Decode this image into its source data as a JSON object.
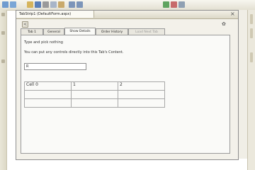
{
  "colors": {
    "toolbar_bg": "#e3e0d2",
    "frame_border": "#8e8e8e",
    "content_bg": "#fafaf8"
  },
  "toolbar": {
    "icons": [
      "back-icon",
      "forward-icon",
      "home-icon",
      "save-icon",
      "cut-icon",
      "copy-icon",
      "paste-icon",
      "undo-icon",
      "redo-icon",
      "run-icon",
      "debug-icon",
      "find-icon"
    ]
  },
  "document": {
    "tab_title": "TabStrip1 (DefaultForm.aspx)",
    "close_glyph": "×",
    "smarttag_glyph": "<",
    "tabs": [
      {
        "label": "Tab 1"
      },
      {
        "label": "General"
      },
      {
        "label": "Show Details"
      },
      {
        "label": "Order History"
      },
      {
        "label": "Load Next Tab"
      }
    ],
    "content": {
      "line1": "Type and pick nothing",
      "line2": "You can put any controls directly into this Tab's Content.",
      "textbox_value": "R",
      "table": [
        [
          "Cell 0",
          "1",
          "2"
        ],
        [
          "",
          "",
          ""
        ],
        [
          "",
          "",
          ""
        ]
      ]
    }
  }
}
